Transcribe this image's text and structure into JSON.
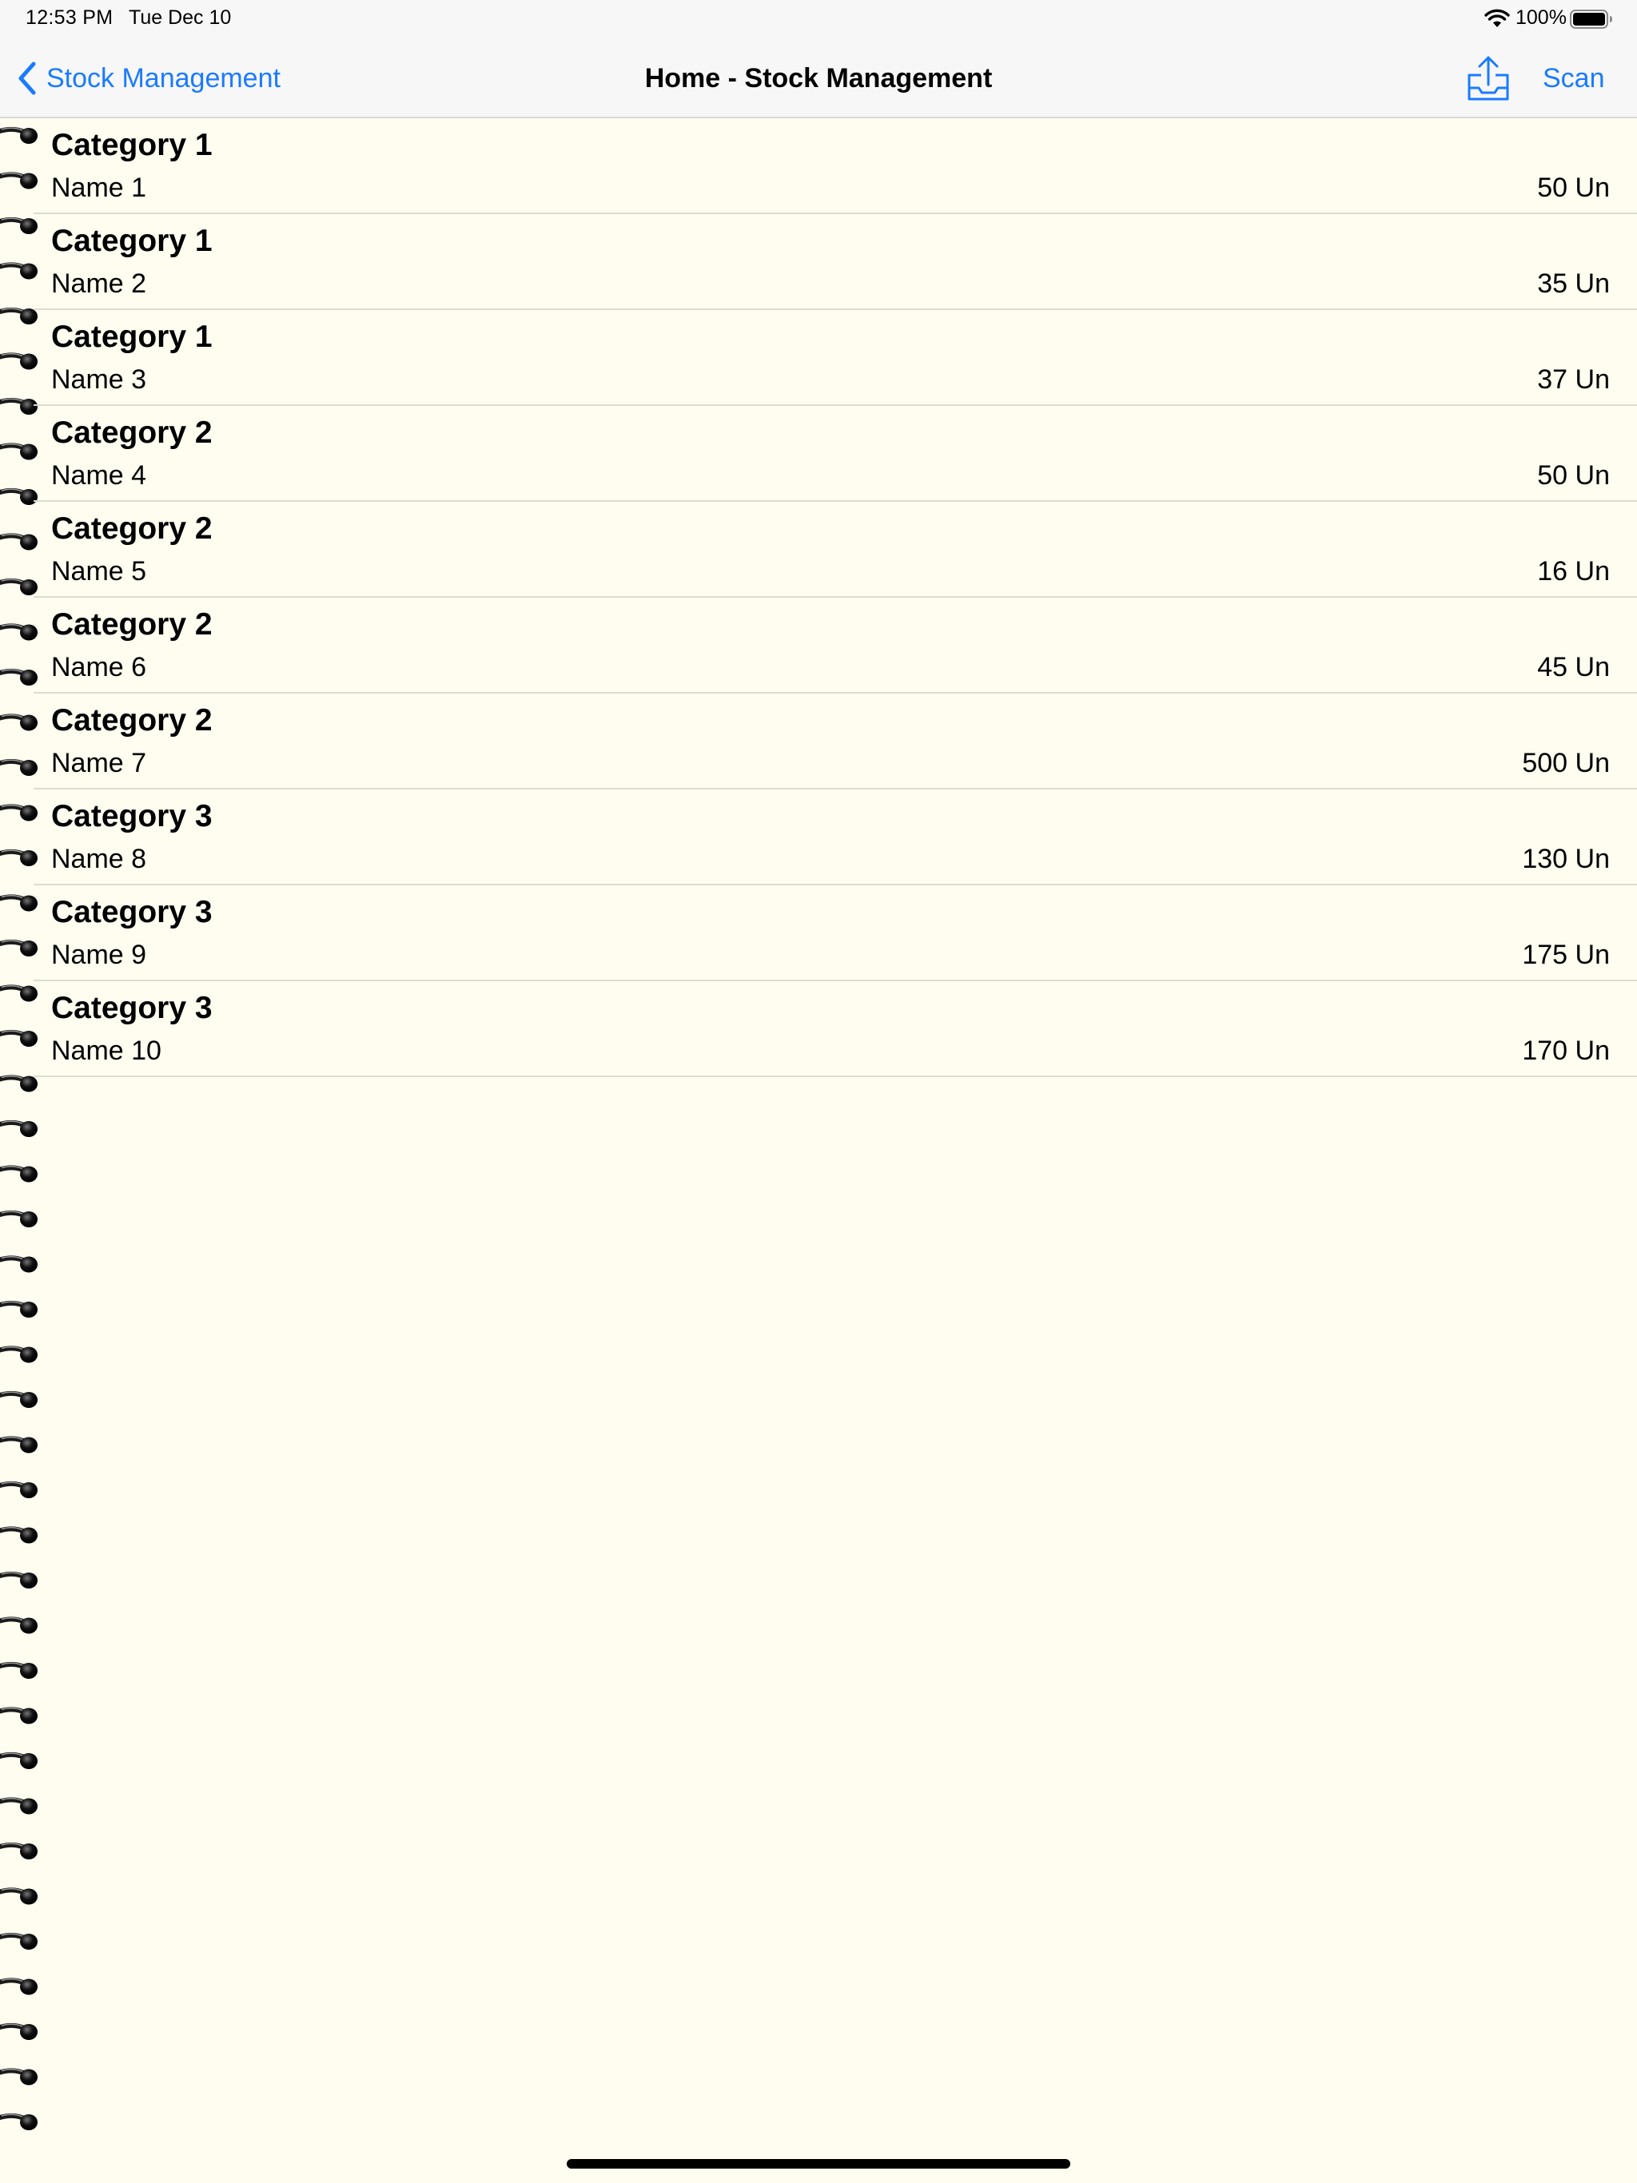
{
  "status_bar": {
    "time": "12:53 PM",
    "date": "Tue Dec 10",
    "battery_pct": "100%",
    "icons": [
      "wifi-icon",
      "battery-icon"
    ]
  },
  "nav": {
    "back_label": "Stock Management",
    "title": "Home - Stock Management",
    "share_icon": "share-icon",
    "scan_label": "Scan"
  },
  "colors": {
    "accent": "#1a7bff",
    "background": "#fefdf0",
    "nav_background": "#f7f7f7",
    "separator": "#dcdcd0"
  },
  "items": [
    {
      "category": "Category 1",
      "name": "Name 1",
      "quantity": "50 Un"
    },
    {
      "category": "Category 1",
      "name": "Name 2",
      "quantity": "35 Un"
    },
    {
      "category": "Category 1",
      "name": "Name 3",
      "quantity": "37 Un"
    },
    {
      "category": "Category 2",
      "name": "Name 4",
      "quantity": "50 Un"
    },
    {
      "category": "Category 2",
      "name": "Name 5",
      "quantity": "16 Un"
    },
    {
      "category": "Category 2",
      "name": "Name 6",
      "quantity": "45 Un"
    },
    {
      "category": "Category 2",
      "name": "Name 7",
      "quantity": "500 Un"
    },
    {
      "category": "Category 3",
      "name": "Name 8",
      "quantity": "130 Un"
    },
    {
      "category": "Category 3",
      "name": "Name 9",
      "quantity": "175 Un"
    },
    {
      "category": "Category 3",
      "name": "Name 10",
      "quantity": "170 Un"
    }
  ]
}
